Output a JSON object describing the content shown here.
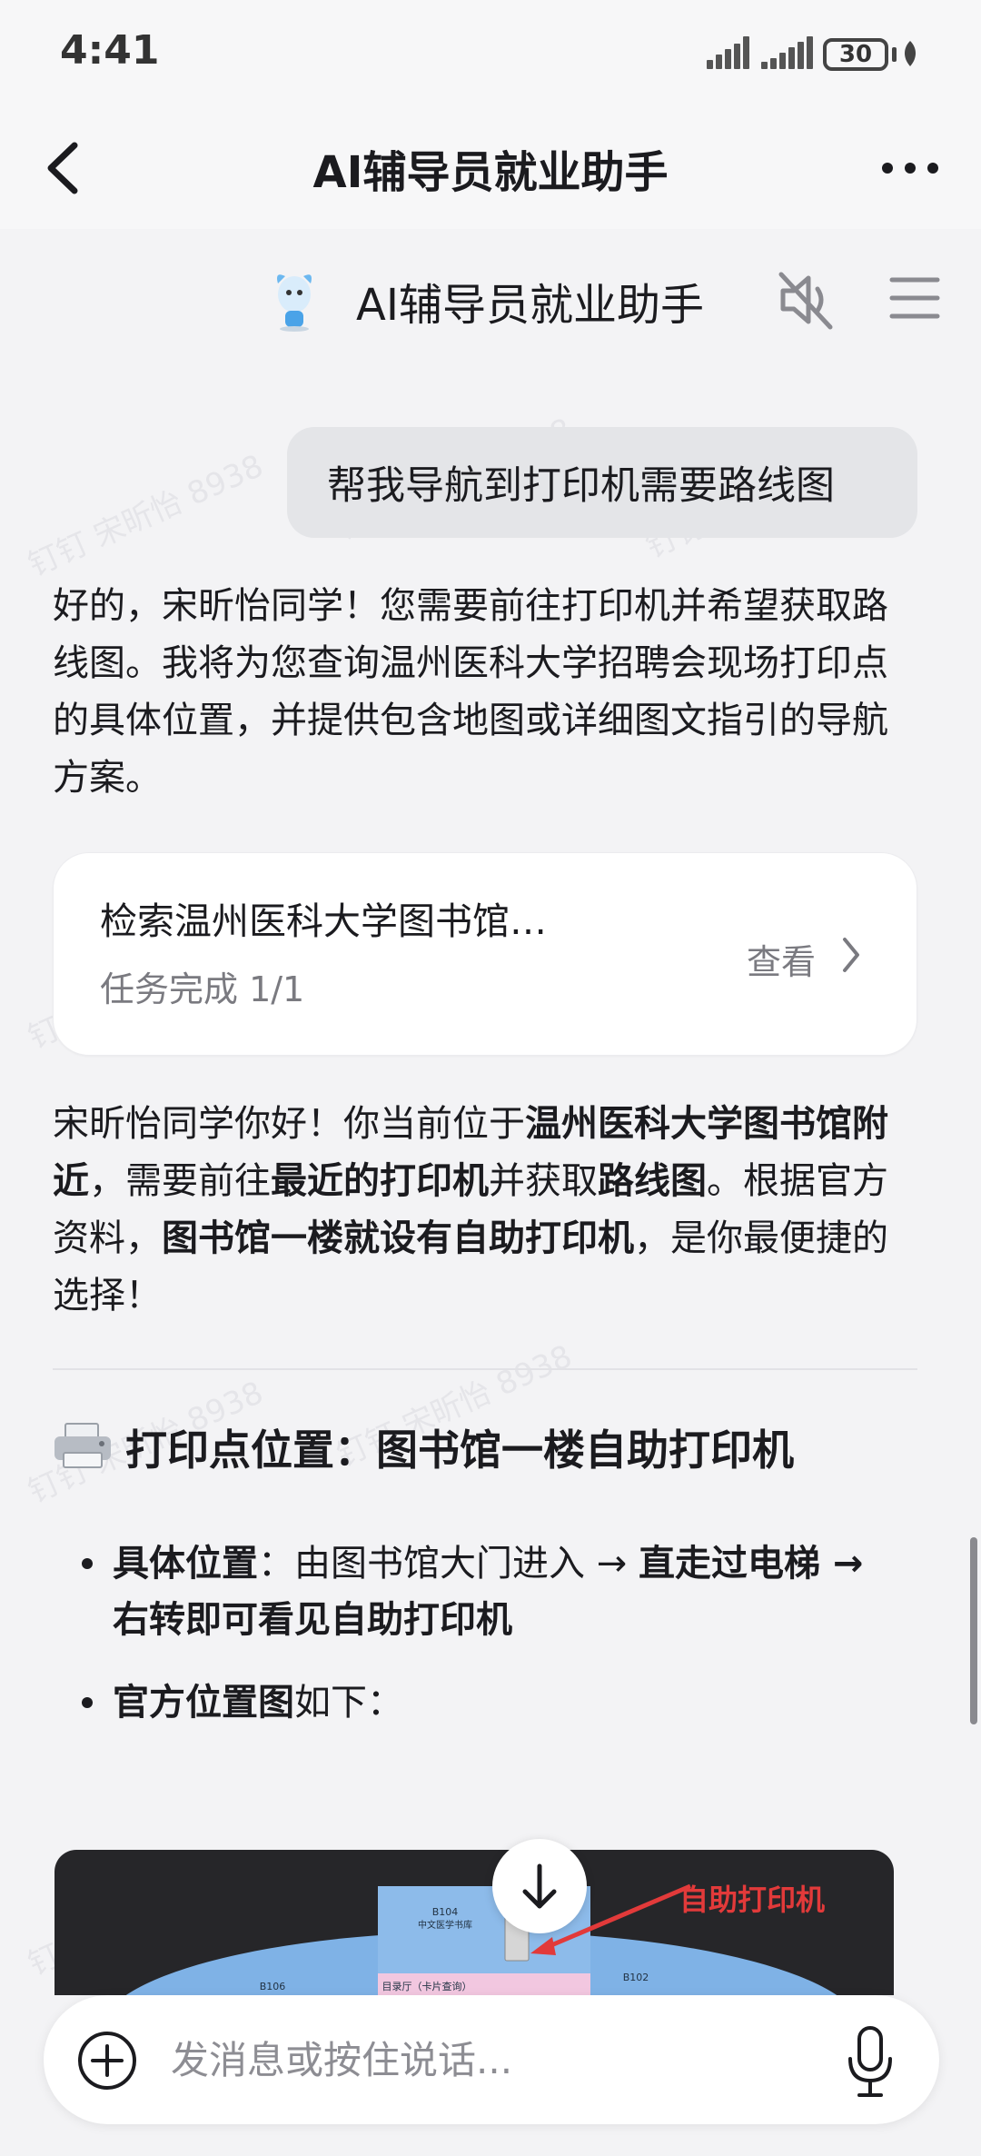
{
  "status_bar": {
    "time": "4:41",
    "battery": "30"
  },
  "nav": {
    "title": "AI辅导员就业助手"
  },
  "agent": {
    "name": "AI辅导员就业助手"
  },
  "user_message": "帮我导航到打印机需要路线图",
  "reply1": "好的，宋昕怡同学！您需要前往打印机并希望获取路线图。我将为您查询温州医科大学招聘会现场打印点的具体位置，并提供包含地图或详细图文指引的导航方案。",
  "task_card": {
    "title": "检索温州医科大学图书馆…",
    "status": "任务完成 1/1",
    "view_label": "查看"
  },
  "reply2": {
    "t1": "宋昕怡同学你好！你当前位于",
    "b1": "温州医科大学图书馆附近",
    "t2": "，需要前往",
    "b2": "最近的打印机",
    "t3": "并获取",
    "b3": "路线图",
    "t4": "。根据官方资料，",
    "b4": "图书馆一楼就设有自助打印机",
    "t5": "，是你最便捷的选择！"
  },
  "section": {
    "icon": "printer-icon",
    "title": "打印点位置：图书馆一楼自助打印机"
  },
  "bullets": [
    {
      "b1": "具体位置",
      "t1": "：由图书馆大门进入 → ",
      "b2": "直走过电梯 → 右转即可看见自助打印机"
    },
    {
      "b1": "官方位置图",
      "t1": "如下："
    }
  ],
  "map": {
    "label": "自助打印机",
    "rooms": {
      "b104": "B104",
      "b104_sub": "中文医学书库",
      "hall": "目录厅（卡片查询）",
      "b102": "B102",
      "b106": "B106"
    }
  },
  "input": {
    "placeholder": "发消息或按住说话..."
  },
  "watermark": "钉钉 宋昕怡 8938",
  "colors": {
    "background": "#f3f3f5",
    "bubble": "#e4e5e8",
    "accent_red": "#e23a3a",
    "map_blue": "#7fb2e6"
  }
}
